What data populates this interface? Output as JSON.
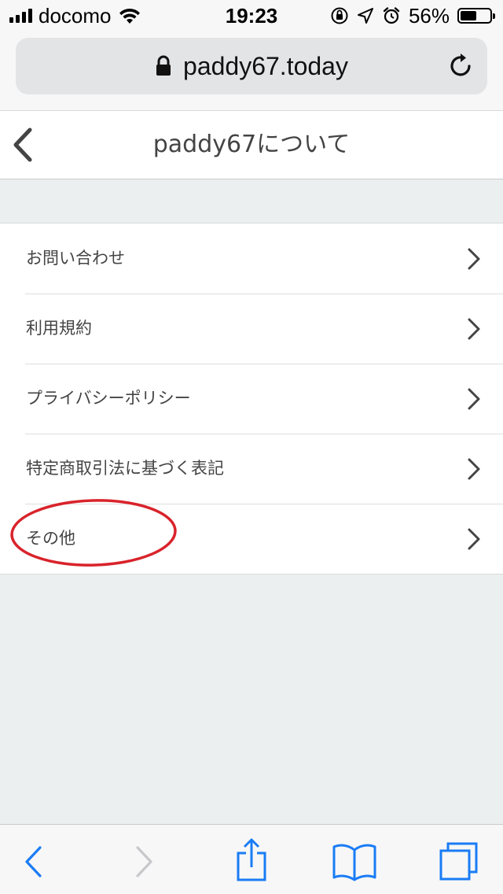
{
  "status_bar": {
    "carrier": "docomo",
    "time": "19:23",
    "battery_percent": "56%",
    "battery_level": 0.56,
    "icons": [
      "signal-icon",
      "wifi-icon",
      "orientation-lock-icon",
      "location-icon",
      "alarm-icon",
      "battery-icon"
    ]
  },
  "browser": {
    "url": "paddy67.today",
    "icons": [
      "lock-icon",
      "reload-icon"
    ]
  },
  "header": {
    "title": "paddy67について",
    "icons": [
      "back-chevron-icon"
    ]
  },
  "menu": {
    "items": [
      {
        "label": "お問い合わせ"
      },
      {
        "label": "利用規約"
      },
      {
        "label": "プライバシーポリシー"
      },
      {
        "label": "特定商取引法に基づく表記"
      },
      {
        "label": "その他"
      }
    ],
    "highlighted_item": "その他",
    "highlight_color": "#d9232b"
  },
  "toolbar": {
    "icons": [
      "back-icon",
      "forward-icon",
      "share-icon",
      "bookmarks-icon",
      "tabs-icon"
    ],
    "accent_color": "#1a7cf5",
    "disabled_color": "#c8c8cc"
  }
}
